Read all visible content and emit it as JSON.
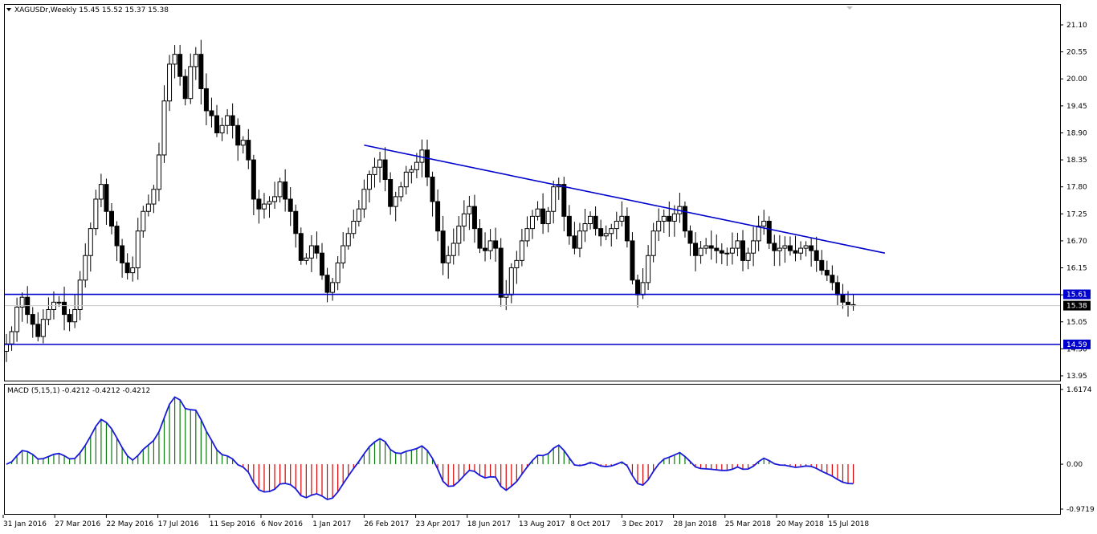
{
  "header": {
    "symbol_line": "XAGUSDr,Weekly  15.45 15.52 15.37 15.38"
  },
  "macd_header": {
    "label": "MACD (5,15,1) -0.4212 -0.4212 -0.4212"
  },
  "colors": {
    "background": "#ffffff",
    "frame": "#000000",
    "trendline": "#0000cc",
    "bull_candle_body": "#ffffff",
    "bear_candle_body": "#000000",
    "macd_line": "#1a1adb",
    "macd_pos": "#0a7a0a",
    "macd_neg": "#dd0000",
    "level_tag": "#0000cc",
    "price_tag": "#000000"
  },
  "chart_data": [
    {
      "type": "candlestick",
      "title": "XAGUSDr,Weekly",
      "ohlc_last": {
        "open": 15.45,
        "high": 15.52,
        "low": 15.37,
        "close": 15.38
      },
      "y_ticks": [
        "21.10",
        "20.55",
        "20.00",
        "19.45",
        "18.90",
        "18.35",
        "17.80",
        "17.25",
        "16.70",
        "16.15",
        "15.60",
        "15.05",
        "14.50",
        "13.95"
      ],
      "ylim": [
        13.95,
        21.1
      ],
      "x_labels": [
        "31 Jan 2016",
        "27 Mar 2016",
        "22 May 2016",
        "17 Jul 2016",
        "11 Sep 2016",
        "6 Nov 2016",
        "1 Jan 2017",
        "26 Feb 2017",
        "23 Apr 2017",
        "18 Jun 2017",
        "13 Aug 2017",
        "8 Oct 2017",
        "3 Dec 2017",
        "28 Jan 2018",
        "25 Mar 2018",
        "20 May 2018",
        "15 Jul 2018"
      ],
      "horizontal_levels": [
        {
          "value": 15.61,
          "label": "15.61"
        },
        {
          "value": 14.59,
          "label": "14.59"
        }
      ],
      "current_price": {
        "value": 15.38,
        "label": "15.38"
      },
      "trendline": {
        "start": {
          "week": 68,
          "price": 18.65
        },
        "end": {
          "week": 167,
          "price": 16.45
        }
      },
      "closes": [
        14.6,
        14.85,
        15.35,
        15.55,
        15.2,
        15.0,
        14.75,
        15.1,
        15.3,
        15.45,
        15.45,
        15.2,
        15.05,
        15.3,
        15.9,
        16.4,
        16.95,
        17.55,
        17.85,
        17.3,
        17.0,
        16.6,
        16.25,
        16.05,
        16.15,
        16.9,
        17.3,
        17.45,
        17.75,
        18.45,
        19.55,
        20.3,
        20.5,
        20.05,
        19.6,
        20.25,
        20.5,
        19.8,
        19.35,
        19.25,
        18.9,
        19.05,
        19.25,
        19.05,
        18.65,
        18.75,
        18.35,
        17.55,
        17.35,
        17.45,
        17.5,
        17.6,
        17.9,
        17.55,
        17.3,
        16.85,
        16.3,
        16.35,
        16.6,
        16.45,
        16.0,
        15.65,
        15.85,
        16.25,
        16.6,
        16.85,
        17.1,
        17.35,
        17.75,
        18.05,
        18.2,
        18.35,
        17.95,
        17.4,
        17.6,
        17.8,
        18.1,
        18.15,
        18.3,
        18.55,
        18.0,
        17.5,
        16.9,
        16.25,
        16.4,
        16.65,
        17.0,
        17.25,
        17.4,
        16.95,
        16.55,
        16.5,
        16.7,
        16.55,
        15.55,
        15.6,
        16.15,
        16.3,
        16.7,
        16.95,
        17.2,
        17.35,
        17.05,
        17.3,
        17.8,
        17.85,
        17.2,
        16.8,
        16.55,
        16.9,
        17.05,
        17.2,
        16.95,
        16.8,
        16.85,
        16.95,
        17.1,
        17.2,
        16.7,
        15.9,
        15.6,
        15.85,
        16.4,
        16.9,
        17.1,
        17.2,
        17.1,
        17.25,
        17.4,
        16.9,
        16.65,
        16.4,
        16.55,
        16.6,
        16.55,
        16.5,
        16.45,
        16.45,
        16.55,
        16.7,
        16.3,
        16.45,
        16.7,
        17.0,
        17.1,
        16.65,
        16.5,
        16.55,
        16.6,
        16.5,
        16.45,
        16.55,
        16.6,
        16.5,
        16.3,
        16.1,
        16.0,
        15.85,
        15.6,
        15.45,
        15.4,
        15.38
      ],
      "note_hidden": ""
    },
    {
      "type": "histogram",
      "title": "MACD (5,15,1)",
      "last_value": -0.4212,
      "y_ticks": [
        "1.6174",
        "0.00",
        "-0.9719"
      ],
      "ylim": [
        -0.9719,
        1.6174
      ]
    }
  ]
}
